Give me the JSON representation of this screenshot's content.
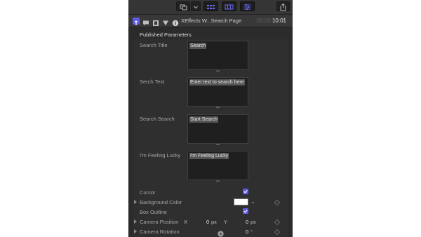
{
  "inspector": {
    "title": "XEffects W...Search Page",
    "timecode_dim": "00:00:",
    "timecode": "10:01"
  },
  "section_title": "Published Parameters",
  "text_params": [
    {
      "label": "Search Title",
      "value": "Search"
    },
    {
      "label": "Serch Text",
      "value": "Enter text to search here"
    },
    {
      "label": "Search Search",
      "value": "Start Search"
    },
    {
      "label": "I'm Feeling Lucky",
      "value": "I'm Feeling Lucky"
    }
  ],
  "cursor": {
    "label": "Cursor",
    "checked": true
  },
  "background_color": {
    "label": "Background Color",
    "color": "#ffffff"
  },
  "box_outline": {
    "label": "Box Outline",
    "checked": true
  },
  "camera_position": {
    "label": "Camera Position",
    "x_label": "X",
    "x_value": "0",
    "x_unit": "px",
    "y_label": "Y",
    "y_value": "0",
    "y_unit": "px"
  },
  "camera_rotation": {
    "label": "Camera Rotation",
    "value": "0",
    "unit": "°"
  },
  "colors": {
    "accent": "#5d5be6",
    "panel": "#2b2b2b"
  }
}
